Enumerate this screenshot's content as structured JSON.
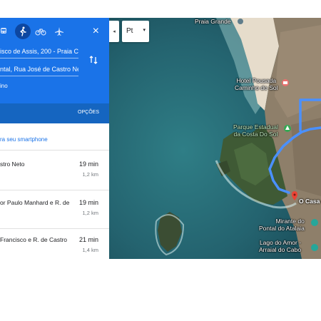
{
  "directions": {
    "origin": "isco de Assis, 200 - Praia C",
    "destination": "ntal, Rua José de Castro Ne",
    "via_fragment": "ino",
    "options_label": "OPÇÕES",
    "send_to_phone": "ra seu smartphone",
    "close_icon": "×",
    "modes": [
      "train-icon",
      "walk-icon",
      "bike-icon",
      "flight-icon"
    ],
    "active_mode": "walk",
    "routes": [
      {
        "name": "stro Neto",
        "time": "19 min",
        "distance": "1,2 km"
      },
      {
        "name": "or Paulo Manhard e R. de",
        "time": "19 min",
        "distance": "1,2 km"
      },
      {
        "name": "Francisco e R. de Castro",
        "time": "21 min",
        "distance": "1,4 km"
      }
    ]
  },
  "map": {
    "collapse_arrow": "◂",
    "select_value": "Pt",
    "select_caret": "▾",
    "labels": {
      "praia_grande": "Praia Grande",
      "hotel": "Hotel Pousada\nCaminho do Sol",
      "parque": "Parque Estadual\nda Costa Do Sol",
      "casa": "O Casa do",
      "mirante": "Mirante do\nPontal do Atalaia",
      "lago": "Lago do Amor -\nArraial do Cabo"
    }
  },
  "colors": {
    "header_blue": "#1a73e8",
    "options_bar": "#1565c0",
    "route_line": "#4a90ff",
    "ocean": "#2a6f7a",
    "sand": "#e6dccb",
    "town": "#8e7f6a",
    "vegetation": "#3f5a35"
  }
}
